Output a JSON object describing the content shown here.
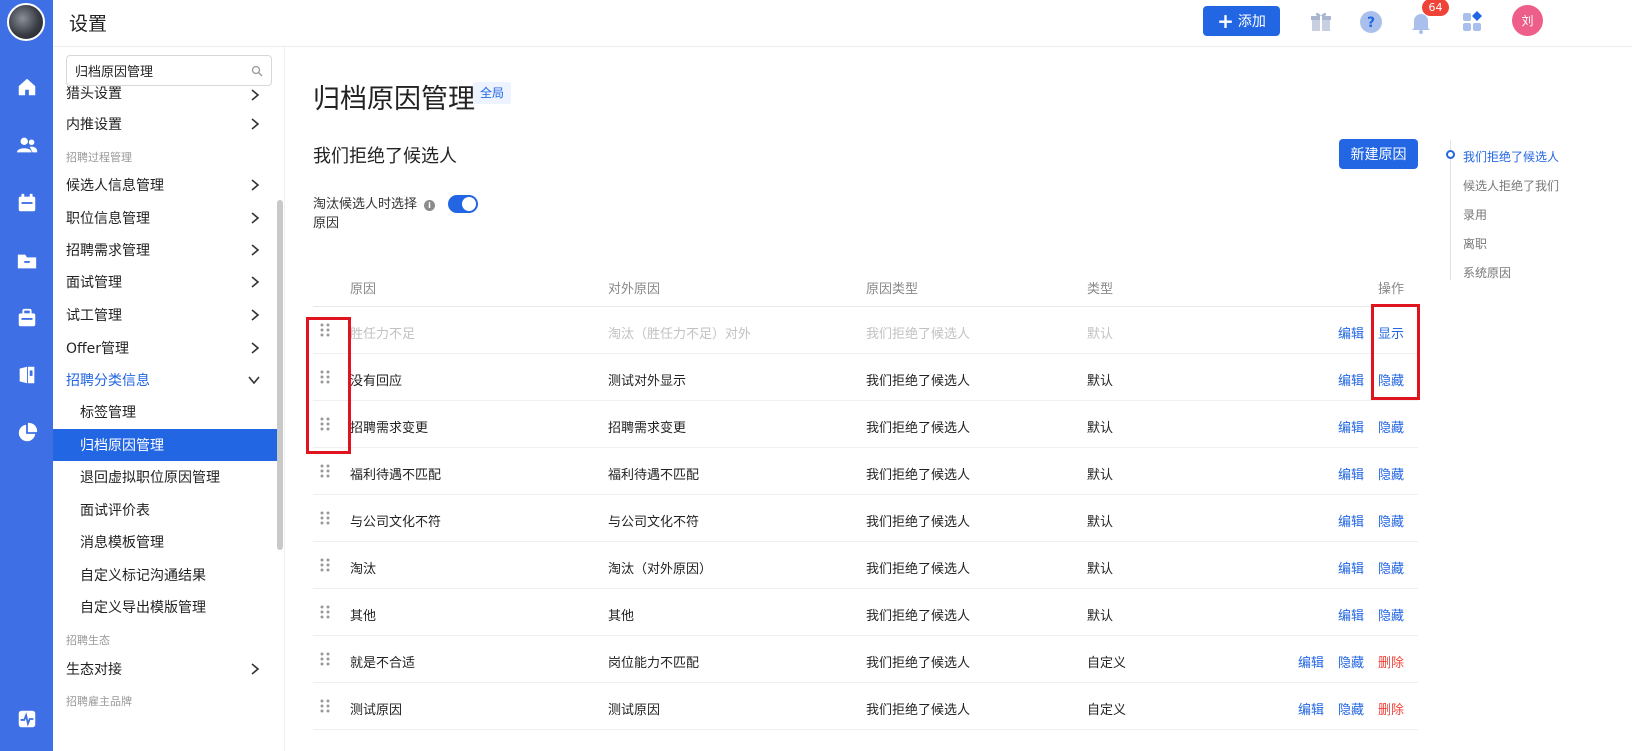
{
  "header": {
    "title": "设置",
    "add_label": "添加",
    "notification_count": "64",
    "avatar_text": "刘"
  },
  "sidebar": {
    "search_value": "归档原因管理",
    "items": [
      {
        "label": "猎头设置",
        "type": "group"
      },
      {
        "label": "内推设置",
        "type": "group"
      },
      {
        "label": "招聘过程管理",
        "type": "section"
      },
      {
        "label": "候选人信息管理",
        "type": "group"
      },
      {
        "label": "职位信息管理",
        "type": "group"
      },
      {
        "label": "招聘需求管理",
        "type": "group"
      },
      {
        "label": "面试管理",
        "type": "group"
      },
      {
        "label": "试工管理",
        "type": "group"
      },
      {
        "label": "Offer管理",
        "type": "group"
      },
      {
        "label": "招聘分类信息",
        "type": "open"
      },
      {
        "label": "标签管理",
        "type": "sub"
      },
      {
        "label": "归档原因管理",
        "type": "active"
      },
      {
        "label": "退回虚拟职位原因管理",
        "type": "sub"
      },
      {
        "label": "面试评价表",
        "type": "sub"
      },
      {
        "label": "消息模板管理",
        "type": "sub"
      },
      {
        "label": "自定义标记沟通结果",
        "type": "sub"
      },
      {
        "label": "自定义导出模版管理",
        "type": "sub"
      },
      {
        "label": "招聘生态",
        "type": "section"
      },
      {
        "label": "生态对接",
        "type": "group"
      },
      {
        "label": "招聘雇主品牌",
        "type": "section"
      }
    ]
  },
  "main": {
    "page_title": "归档原因管理",
    "scope_tag": "全局",
    "section_title": "我们拒绝了候选人",
    "new_button": "新建原因",
    "option_label": "淘汰候选人时选择原因",
    "option_enabled": true,
    "columns": [
      "原因",
      "对外原因",
      "原因类型",
      "类型",
      "操作"
    ],
    "rows": [
      {
        "reason": "胜任力不足",
        "external": "淘汰（胜任力不足）对外",
        "reason_type": "我们拒绝了候选人",
        "type": "默认",
        "actions": [
          "编辑",
          "显示"
        ],
        "hidden": true
      },
      {
        "reason": "没有回应",
        "external": "测试对外显示",
        "reason_type": "我们拒绝了候选人",
        "type": "默认",
        "actions": [
          "编辑",
          "隐藏"
        ],
        "hidden": false
      },
      {
        "reason": "招聘需求变更",
        "external": "招聘需求变更",
        "reason_type": "我们拒绝了候选人",
        "type": "默认",
        "actions": [
          "编辑",
          "隐藏"
        ],
        "hidden": false
      },
      {
        "reason": "福利待遇不匹配",
        "external": "福利待遇不匹配",
        "reason_type": "我们拒绝了候选人",
        "type": "默认",
        "actions": [
          "编辑",
          "隐藏"
        ],
        "hidden": false
      },
      {
        "reason": "与公司文化不符",
        "external": "与公司文化不符",
        "reason_type": "我们拒绝了候选人",
        "type": "默认",
        "actions": [
          "编辑",
          "隐藏"
        ],
        "hidden": false
      },
      {
        "reason": "淘汰",
        "external": "淘汰（对外原因）",
        "reason_type": "我们拒绝了候选人",
        "type": "默认",
        "actions": [
          "编辑",
          "隐藏"
        ],
        "hidden": false
      },
      {
        "reason": "其他",
        "external": "其他",
        "reason_type": "我们拒绝了候选人",
        "type": "默认",
        "actions": [
          "编辑",
          "隐藏"
        ],
        "hidden": false
      },
      {
        "reason": "就是不合适",
        "external": "岗位能力不匹配",
        "reason_type": "我们拒绝了候选人",
        "type": "自定义",
        "actions": [
          "编辑",
          "隐藏",
          "删除"
        ],
        "hidden": false
      },
      {
        "reason": "测试原因",
        "external": "测试原因",
        "reason_type": "我们拒绝了候选人",
        "type": "自定义",
        "actions": [
          "编辑",
          "隐藏",
          "删除"
        ],
        "hidden": false
      }
    ]
  },
  "anchor_nav": {
    "items": [
      "我们拒绝了候选人",
      "候选人拒绝了我们",
      "录用",
      "离职",
      "系统原因"
    ],
    "current": 0
  },
  "colors": {
    "primary": "#2266e3",
    "rail": "#3e6fe5",
    "danger": "#f04338",
    "highlight": "#e0141e"
  },
  "icons": {
    "rail": [
      "home-icon",
      "users-icon",
      "calendar-icon",
      "folder-icon",
      "briefcase-icon",
      "book-icon",
      "pie-chart-icon",
      "activity-icon"
    ],
    "topbar": [
      "gift-icon",
      "help-icon",
      "bell-icon",
      "apps-icon"
    ]
  }
}
